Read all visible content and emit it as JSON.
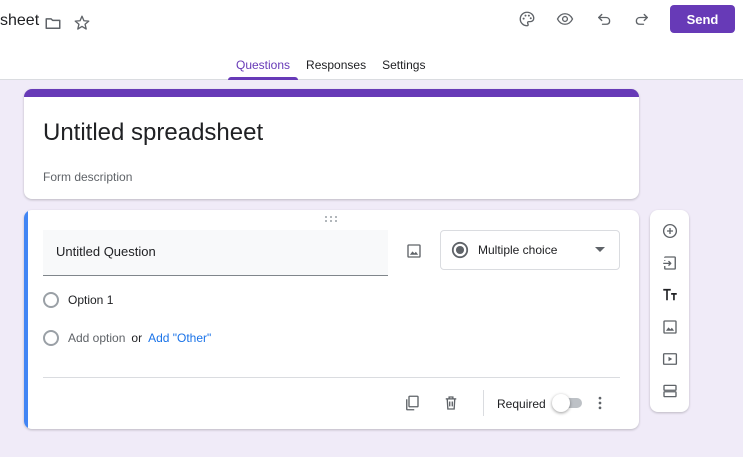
{
  "header": {
    "doc_title": "sheet",
    "send_label": "Send",
    "icons": {
      "folder": "folder-icon",
      "star": "star-icon",
      "palette": "palette-icon",
      "preview": "eye-icon",
      "undo": "undo-icon",
      "redo": "redo-icon"
    }
  },
  "tabs": [
    {
      "label": "Questions",
      "active": true
    },
    {
      "label": "Responses",
      "active": false
    },
    {
      "label": "Settings",
      "active": false
    }
  ],
  "form": {
    "title": "Untitled spreadsheet",
    "description_placeholder": "Form description"
  },
  "question": {
    "title": "Untitled Question",
    "type": "Multiple choice",
    "options": [
      "Option 1"
    ],
    "add_option_label": "Add option",
    "or_label": "or",
    "add_other_label": "Add \"Other\"",
    "required_label": "Required",
    "required": false
  },
  "side_toolbar": [
    "add-question-icon",
    "import-questions-icon",
    "add-title-icon",
    "add-image-icon",
    "add-video-icon",
    "add-section-icon"
  ],
  "colors": {
    "accent": "#673ab7",
    "background": "#f0ebf8",
    "active_question": "#4285f4",
    "link": "#1a73e8"
  }
}
